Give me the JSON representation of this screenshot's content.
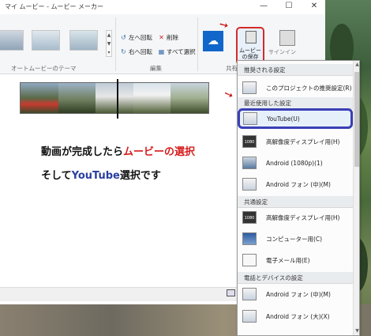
{
  "window": {
    "title": "マイ ムービー - ムービー メーカー",
    "minimize": "—",
    "maximize": "☐",
    "close": "✕"
  },
  "ribbon": {
    "themes_group_label": "オートムービーのテーマ",
    "edit_group_label": "編集",
    "share_group_label": "共有",
    "rotate_left": "左へ回転",
    "rotate_right": "右へ回転",
    "delete": "削除",
    "select_all": "すべて選択",
    "movie_save_label": "ムービーの保存",
    "publish_label": "サインイン"
  },
  "caption": {
    "line1_prefix": "動画が完成したら",
    "line1_highlight": "ムービーの選択",
    "line2_prefix": "そして",
    "line2_highlight": "YouTube",
    "line2_suffix": "選択です"
  },
  "menu": {
    "sections": [
      {
        "header": "推奨される設定"
      },
      {
        "header": "最近使用した設定"
      },
      {
        "header": "共通設定"
      },
      {
        "header": "電話とデバイスの設定"
      }
    ],
    "items": [
      {
        "label": "このプロジェクトの推奨設定(R)",
        "icon": "recommend-icon"
      },
      {
        "label": "YouTube(U)",
        "icon": "youtube-icon"
      },
      {
        "label": "高解像度ディスプレイ用(H)",
        "icon": "hd-display-icon"
      },
      {
        "label": "Android (1080p)(1)",
        "icon": "android-phone-icon"
      },
      {
        "label": "Android フォン (中)(M)",
        "icon": "android-phone-icon"
      },
      {
        "label": "高解像度ディスプレイ用(H)",
        "icon": "hd-display-icon"
      },
      {
        "label": "コンピューター用(C)",
        "icon": "computer-icon"
      },
      {
        "label": "電子メール用(E)",
        "icon": "email-icon"
      },
      {
        "label": "Android フォン (中)(M)",
        "icon": "android-phone-icon"
      },
      {
        "label": "Android フォン (大)(X)",
        "icon": "android-phone-icon"
      }
    ],
    "icon_hd_text": "1080"
  },
  "colors": {
    "highlight_border": "#3a3fb5",
    "annotation_red": "#d61c1c",
    "annotation_blue": "#2b3fa0",
    "onedrive_blue": "#1067c9"
  }
}
